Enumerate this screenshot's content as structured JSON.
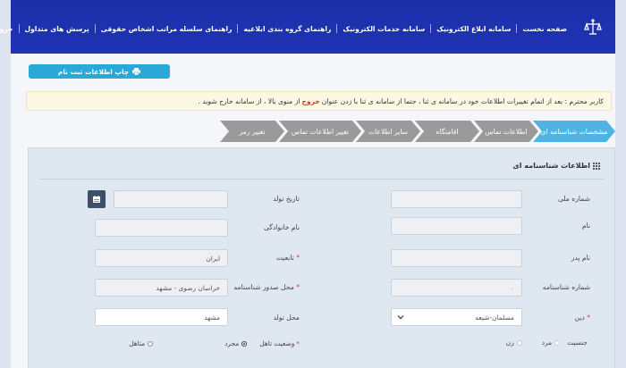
{
  "nav": {
    "items": [
      {
        "label": "صفحه نخست"
      },
      {
        "label": "سامانه ابلاغ الکترونیک"
      },
      {
        "label": "سامانه خدمات الکترونیک"
      },
      {
        "label": "راهنمای گروه بندی ابلاغیه"
      },
      {
        "label": "راهنمای سلسله مراتب اشخاص حقوقی"
      },
      {
        "label": "پرسش های متداول"
      },
      {
        "label": "خروج"
      }
    ]
  },
  "print_button": {
    "label": "چاپ اطلاعات ثبت نام",
    "icon": "printer-icon"
  },
  "notice": {
    "text_before": "کاربر محترم : بعد از اتمام تغییرات اطلاعات خود در سامانه ی ثنا ، حتما از سامانه ی ثنا با زدن عنوان",
    "highlight": "خروج",
    "text_after": "از منوی بالا ، از سامانه خارج شوید ."
  },
  "tabs": [
    {
      "label": "مشخصات شناسنامه ای",
      "active": true
    },
    {
      "label": "اطلاعات تماس",
      "active": false
    },
    {
      "label": "اقامتگاه",
      "active": false
    },
    {
      "label": "سایر اطلاعات",
      "active": false
    },
    {
      "label": "تغییر اطلاعات تماس",
      "active": false
    },
    {
      "label": "تغییر رمز",
      "active": false
    }
  ],
  "panel": {
    "title": "اطلاعات شناسنامه ای",
    "icon": "grid-icon"
  },
  "form": {
    "national_id": {
      "label": "شماره ملی",
      "value": ""
    },
    "birth_date": {
      "label": "تاریخ تولد",
      "value": ""
    },
    "first_name": {
      "label": "نام",
      "value": ""
    },
    "last_name": {
      "label": "نام خانوادگی",
      "value": ""
    },
    "father_name": {
      "label": "نام پدر",
      "value": ""
    },
    "nationality": {
      "label": "تابعیت",
      "value": "ایران",
      "required": "*"
    },
    "id_number": {
      "label": "شماره شناسنامه",
      "value": "۰"
    },
    "issue_place": {
      "label": "محل صدور شناسنامه",
      "value": "خراسان رضوی - مشهد",
      "required": "*"
    },
    "religion": {
      "label": "دین",
      "value": "مسلمان-شیعه",
      "required": "*"
    },
    "birth_place": {
      "label": "محل تولد",
      "value": "مشهد"
    },
    "gender": {
      "label": "جنسیت",
      "options": [
        "مرد",
        "زن"
      ]
    },
    "marital": {
      "label": "وضعیت تاهل",
      "options": [
        "مجرد",
        "متاهل"
      ],
      "selected": "مجرد",
      "required": "*"
    }
  },
  "colors": {
    "header": "#1f33b5",
    "tab_active": "#4fb3e6",
    "tab_inactive": "#9a9a9a",
    "print_button": "#29a9d8",
    "required": "#d9382b"
  }
}
